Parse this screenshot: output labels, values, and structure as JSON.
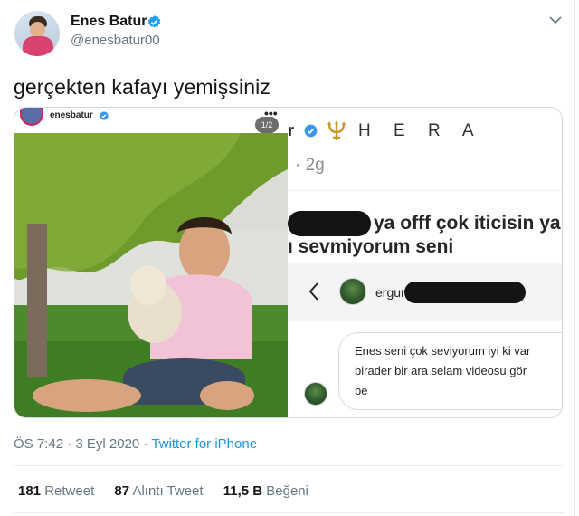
{
  "tweet": {
    "author_name": "Enes Batur",
    "author_handle": "@enesbatur00",
    "text": "gerçekten kafayı yemişsiniz",
    "timestamp": "ÖS 7:42 · 3 Eyl 2020 · ",
    "source": "Twitter for iPhone"
  },
  "media_left": {
    "account": "enesbatur",
    "more": "•••",
    "counter": "1/2"
  },
  "media_right": {
    "name_fragment": "r",
    "display_tail": "H E R A",
    "time": "· 2g",
    "reply_line1": "ya offf çok iticisin ya",
    "reply_line2": "ı sevmiyorum seni",
    "dm_name": "ergun",
    "message": "Enes seni çok seviyorum iyi ki var\nbirader bir ara selam videosu gör\nbe"
  },
  "stats": {
    "retweets_count": "181",
    "retweets_label": "Retweet",
    "quotes_count": "87",
    "quotes_label": "Alıntı Tweet",
    "likes_count": "11,5 B",
    "likes_label": "Beğeni"
  },
  "colors": {
    "verified": "#1da1f2",
    "link": "#1b95e0",
    "muted": "#657786"
  },
  "icons": [
    "verified-badge-icon",
    "chevron-down-icon",
    "trident-icon",
    "back-arrow-icon"
  ]
}
